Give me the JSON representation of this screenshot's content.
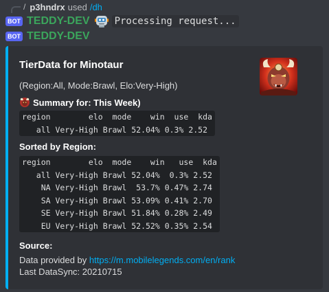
{
  "command": {
    "user": "p3hndrx",
    "used_text": "used",
    "command_name": "/dh"
  },
  "messages": [
    {
      "bot_tag": "BOT",
      "author": "TEDDY-DEV",
      "icon": "robot-icon",
      "text": "Processing request..."
    },
    {
      "bot_tag": "BOT",
      "author": "TEDDY-DEV"
    }
  ],
  "embed": {
    "accent_color": "#00aff4",
    "title": "TierData for Minotaur",
    "description": "(Region:All, Mode:Brawl, Elo:Very-High)",
    "thumbnail": "minotaur-hero-portrait",
    "summary": {
      "icon": "minotaur-emblem-icon",
      "title": "Summary for: This Week)",
      "table": [
        "region        elo  mode    win  use  kda",
        "   all Very-High Brawl 52.04% 0.3% 2.52"
      ]
    },
    "sorted": {
      "title": "Sorted by Region:",
      "table": [
        "region        elo  mode    win   use  kda",
        "   all Very-High Brawl 52.04%  0.3% 2.52",
        "    NA Very-High Brawl  53.7% 0.47% 2.74",
        "    SA Very-High Brawl 53.09% 0.41% 2.70",
        "    SE Very-High Brawl 51.84% 0.28% 2.49",
        "    EU Very-High Brawl 52.52% 0.35% 2.54"
      ]
    },
    "source": {
      "title": "Source:",
      "prefix": "Data provided by ",
      "link": "https://m.mobilelegends.com/en/rank",
      "sync": "Last DataSync: 20210715"
    }
  }
}
